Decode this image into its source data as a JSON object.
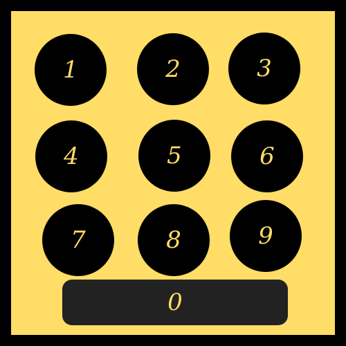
{
  "keypad": {
    "keys": [
      "1",
      "2",
      "3",
      "4",
      "5",
      "6",
      "7",
      "8",
      "9"
    ],
    "zero": "0"
  },
  "colors": {
    "frame": "#000000",
    "background": "#FFDD66",
    "key": "#000000",
    "zero_key": "#222222",
    "digit": "#FFDD66"
  }
}
